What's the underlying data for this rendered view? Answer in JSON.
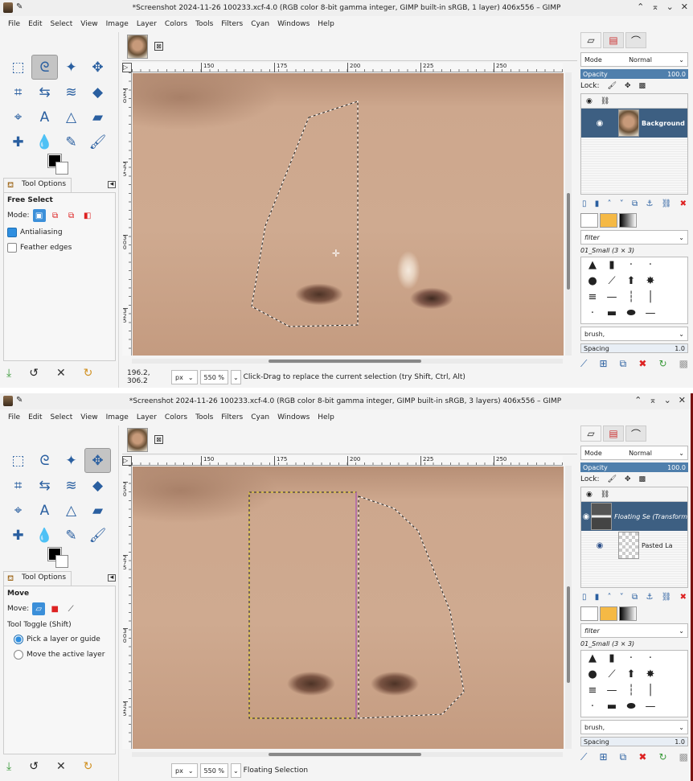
{
  "windows": [
    {
      "title": "*Screenshot 2024-11-26 100233.xcf-4.0 (RGB color 8-bit gamma integer, GIMP built-in sRGB, 1 layer) 406x556 – GIMP",
      "menu": [
        "File",
        "Edit",
        "Select",
        "View",
        "Image",
        "Layer",
        "Colors",
        "Tools",
        "Filters",
        "Cyan",
        "Windows",
        "Help"
      ],
      "active_tool": 1,
      "tool_options": {
        "tab": "Tool Options",
        "tool": "Free Select",
        "mode_label": "Mode:",
        "checks": [
          {
            "label": "Antialiasing",
            "checked": true
          },
          {
            "label": "Feather edges",
            "checked": false
          }
        ]
      },
      "ruler": {
        "h": [
          "150",
          "175",
          "200",
          "225",
          "250"
        ],
        "v": [
          "250",
          "275",
          "300",
          "325"
        ]
      },
      "status": {
        "coords": "196.2, 306.2",
        "unit": "px",
        "zoom": "550 %",
        "message": "Click-Drag to replace the current selection (try Shift, Ctrl, Alt)"
      },
      "layers": {
        "mode_label": "Mode",
        "mode": "Normal",
        "opacity_label": "Opacity",
        "opacity": "100.0",
        "lock_label": "Lock:",
        "items": [
          {
            "name": "Background",
            "selected": true,
            "thumb": "face"
          }
        ]
      },
      "brushes": {
        "filter": "filter",
        "set": "01_Small (3 × 3)",
        "preset": "brush,",
        "spacing_label": "Spacing",
        "spacing": "1.0"
      }
    },
    {
      "title": "*Screenshot 2024-11-26 100233.xcf-4.0 (RGB color 8-bit gamma integer, GIMP built-in sRGB, 3 layers) 406x556 – GIMP",
      "menu": [
        "File",
        "Edit",
        "Select",
        "View",
        "Image",
        "Layer",
        "Colors",
        "Tools",
        "Filters",
        "Cyan",
        "Windows",
        "Help"
      ],
      "active_tool": 3,
      "tool_options": {
        "tab": "Tool Options",
        "tool": "Move",
        "mode_label": "Move:",
        "toggle_label": "Tool Toggle  (Shift)",
        "radios": [
          {
            "label": "Pick a layer or guide",
            "checked": true
          },
          {
            "label": "Move the active layer",
            "checked": false
          }
        ]
      },
      "ruler": {
        "h": [
          "150",
          "175",
          "200",
          "225",
          "250"
        ],
        "v": [
          "250",
          "275",
          "300",
          "325"
        ]
      },
      "status": {
        "coords": "",
        "unit": "px",
        "zoom": "550 %",
        "message": "Floating Selection"
      },
      "layers": {
        "mode_label": "Mode",
        "mode": "Normal",
        "opacity_label": "Opacity",
        "opacity": "100.0",
        "lock_label": "Lock:",
        "items": [
          {
            "name": "Floating Se (Transform",
            "selected": true,
            "thumb": "float"
          },
          {
            "name": "Pasted La",
            "selected": false,
            "thumb": "check"
          }
        ]
      },
      "brushes": {
        "filter": "filter",
        "set": "01_Small (3 × 3)",
        "preset": "brush,",
        "spacing_label": "Spacing",
        "spacing": "1.0"
      }
    }
  ],
  "colors": {
    "selection_w1": "#e0d020",
    "layer_boundary": "#a040c0",
    "active_layer": "#3d5f82"
  }
}
